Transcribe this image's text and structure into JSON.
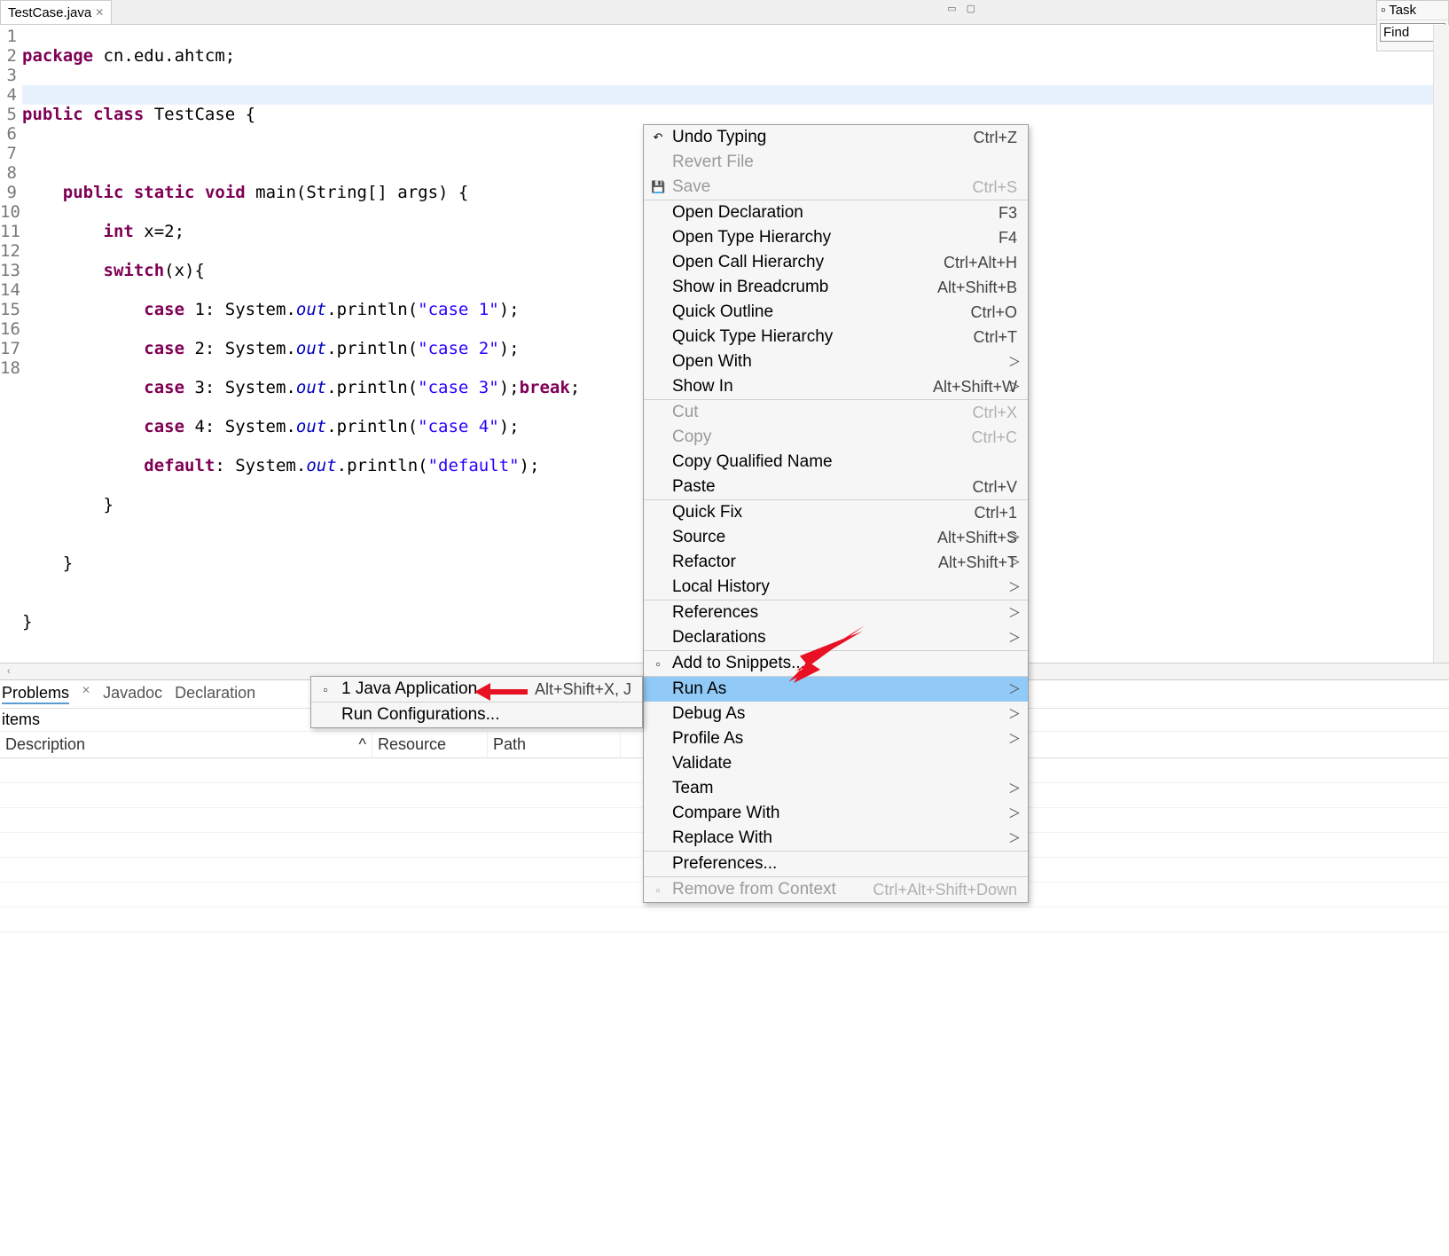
{
  "tab": {
    "title": "TestCase.java"
  },
  "task": {
    "title": "Task",
    "find": "Find"
  },
  "gutter": [
    "1",
    "2",
    "3",
    "4",
    "5",
    "6",
    "7",
    "8",
    "9",
    "10",
    "11",
    "12",
    "13",
    "14",
    "15",
    "16",
    "17",
    "18"
  ],
  "code": {
    "l1": {
      "kw1": "package",
      "pkg": " cn.edu.ahtcm;"
    },
    "l3": {
      "kw1": "public",
      "kw2": "class",
      "name": " TestCase {"
    },
    "l5": {
      "kw1": "public",
      "kw2": "static",
      "kw3": "void",
      "sig": " main(String[] args) {"
    },
    "l6": {
      "kw": "int",
      "rest": " x=2;"
    },
    "l7": {
      "kw": "switch",
      "rest": "(x){"
    },
    "l8": {
      "kw": "case",
      "n": " 1: System.",
      "out": "out",
      "call": ".println(",
      "s": "\"case 1\"",
      "end": ");"
    },
    "l9": {
      "kw": "case",
      "n": " 2: System.",
      "out": "out",
      "call": ".println(",
      "s": "\"case 2\"",
      "end": ");"
    },
    "l10": {
      "kw": "case",
      "n": " 3: System.",
      "out": "out",
      "call": ".println(",
      "s": "\"case 3\"",
      "end": ");",
      "brk": "break",
      "semi": ";"
    },
    "l11": {
      "kw": "case",
      "n": " 4: System.",
      "out": "out",
      "call": ".println(",
      "s": "\"case 4\"",
      "end": ");"
    },
    "l12": {
      "kw": "default",
      "n": ": System.",
      "out": "out",
      "call": ".println(",
      "s": "\"default\"",
      "end": ");"
    },
    "l13": "        }",
    "l14": "",
    "l15": "    }",
    "l16": "",
    "l17": "}",
    "l18": ""
  },
  "problems": {
    "tabs": [
      "Problems",
      "Javadoc",
      "Declaration"
    ],
    "items": "items",
    "cols": {
      "desc": "Description",
      "res": "Resource",
      "path": "Path"
    },
    "sort": "^"
  },
  "menu": {
    "g1": [
      {
        "label": "Undo Typing",
        "sc": "Ctrl+Z",
        "ico": "↶"
      },
      {
        "label": "Revert File",
        "dis": true
      },
      {
        "label": "Save",
        "sc": "Ctrl+S",
        "dis": true,
        "ico": "💾"
      }
    ],
    "g2": [
      {
        "label": "Open Declaration",
        "sc": "F3"
      },
      {
        "label": "Open Type Hierarchy",
        "sc": "F4"
      },
      {
        "label": "Open Call Hierarchy",
        "sc": "Ctrl+Alt+H"
      },
      {
        "label": "Show in Breadcrumb",
        "sc": "Alt+Shift+B"
      },
      {
        "label": "Quick Outline",
        "sc": "Ctrl+O"
      },
      {
        "label": "Quick Type Hierarchy",
        "sc": "Ctrl+T"
      },
      {
        "label": "Open With",
        "sub": true
      },
      {
        "label": "Show In",
        "sc": "Alt+Shift+W",
        "sub": true
      }
    ],
    "g3": [
      {
        "label": "Cut",
        "sc": "Ctrl+X",
        "dis": true
      },
      {
        "label": "Copy",
        "sc": "Ctrl+C",
        "dis": true
      },
      {
        "label": "Copy Qualified Name"
      },
      {
        "label": "Paste",
        "sc": "Ctrl+V"
      }
    ],
    "g4": [
      {
        "label": "Quick Fix",
        "sc": "Ctrl+1"
      },
      {
        "label": "Source",
        "sc": "Alt+Shift+S",
        "sub": true
      },
      {
        "label": "Refactor",
        "sc": "Alt+Shift+T",
        "sub": true
      },
      {
        "label": "Local History",
        "sub": true
      }
    ],
    "g5": [
      {
        "label": "References",
        "sub": true
      },
      {
        "label": "Declarations",
        "sub": true
      }
    ],
    "g6": [
      {
        "label": "Add to Snippets...",
        "ico": "▫"
      }
    ],
    "g7": [
      {
        "label": "Run As",
        "sub": true,
        "sel": true
      },
      {
        "label": "Debug As",
        "sub": true
      },
      {
        "label": "Profile As",
        "sub": true
      },
      {
        "label": "Validate"
      },
      {
        "label": "Team",
        "sub": true
      },
      {
        "label": "Compare With",
        "sub": true
      },
      {
        "label": "Replace With",
        "sub": true
      }
    ],
    "g8": [
      {
        "label": "Preferences..."
      }
    ],
    "g9": [
      {
        "label": "Remove from Context",
        "sc": "Ctrl+Alt+Shift+Down",
        "dis": true,
        "ico": "▫"
      }
    ]
  },
  "submenu": {
    "i1": {
      "label": "1 Java Application",
      "sc": "Alt+Shift+X, J",
      "ico": "▫"
    },
    "i2": {
      "label": "Run Configurations..."
    }
  }
}
